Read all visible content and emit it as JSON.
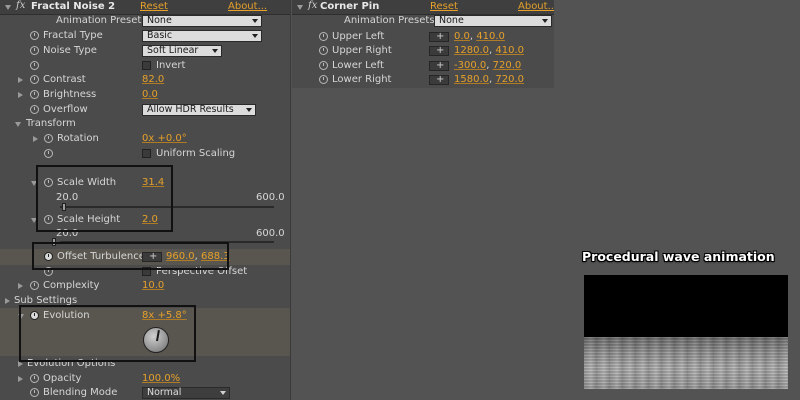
{
  "left_panel": {
    "title": "Fractal Noise 2",
    "reset": "Reset",
    "about": "About...",
    "presets_label": "Animation Presets:",
    "presets_value": "None",
    "fractal_type": {
      "label": "Fractal Type",
      "value": "Basic"
    },
    "noise_type": {
      "label": "Noise Type",
      "value": "Soft Linear"
    },
    "invert": {
      "label": "Invert"
    },
    "contrast": {
      "label": "Contrast",
      "value": "82.0"
    },
    "brightness": {
      "label": "Brightness",
      "value": "0.0"
    },
    "overflow": {
      "label": "Overflow",
      "value": "Allow HDR Results"
    },
    "transform": {
      "label": "Transform"
    },
    "rotation": {
      "label": "Rotation",
      "value": "0x +0.0°"
    },
    "uniform_scaling": {
      "label": "Uniform Scaling"
    },
    "scale_width": {
      "label": "Scale Width",
      "value": "31.4",
      "min": "20.0",
      "max": "600.0"
    },
    "scale_height": {
      "label": "Scale Height",
      "value": "2.0",
      "min": "20.0",
      "max": "600.0"
    },
    "offset_turbulence": {
      "label": "Offset Turbulence",
      "x": "960.0",
      "y": "688.3",
      "sep": ","
    },
    "perspective_offset": {
      "label": "Perspective Offset"
    },
    "complexity": {
      "label": "Complexity",
      "value": "10.0"
    },
    "sub_settings": {
      "label": "Sub Settings"
    },
    "evolution": {
      "label": "Evolution",
      "value": "8x +5.8°"
    },
    "evolution_options": {
      "label": "Evolution Options"
    },
    "opacity": {
      "label": "Opacity",
      "value": "100.0%"
    },
    "blending_mode": {
      "label": "Blending Mode",
      "value": "Normal"
    }
  },
  "right_panel": {
    "title": "Corner Pin",
    "reset": "Reset",
    "about": "About...",
    "presets_label": "Animation Presets:",
    "presets_value": "None",
    "upper_left": {
      "label": "Upper Left",
      "x": "0.0",
      "y": "410.0"
    },
    "upper_right": {
      "label": "Upper Right",
      "x": "1280.0",
      "y": "410.0"
    },
    "lower_left": {
      "label": "Lower Left",
      "x": "-300.0",
      "y": "720.0"
    },
    "lower_right": {
      "label": "Lower Right",
      "x": "1580.0",
      "y": "720.0"
    },
    "sep": ","
  },
  "preview": {
    "caption": "Procedural wave animation"
  }
}
